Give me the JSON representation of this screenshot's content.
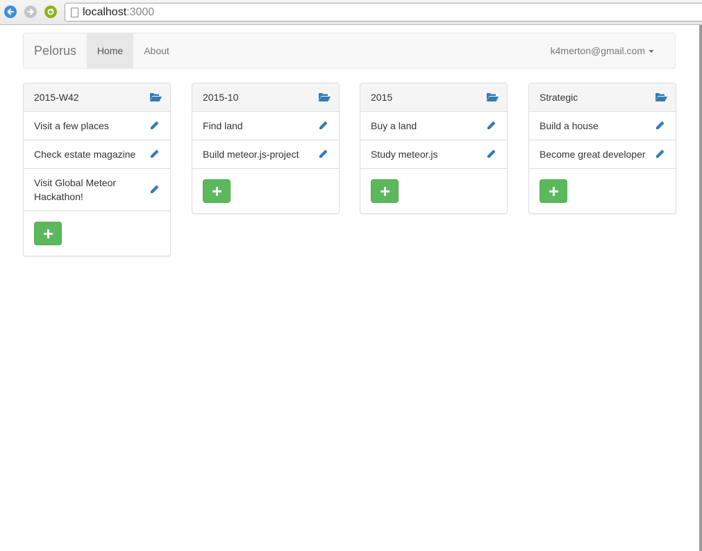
{
  "browser": {
    "url_host": "localhost",
    "url_port": ":3000"
  },
  "navbar": {
    "brand": "Pelorus",
    "items": [
      {
        "label": "Home",
        "active": true
      },
      {
        "label": "About",
        "active": false
      }
    ],
    "user": "k4merton@gmail.com"
  },
  "panels": [
    {
      "title": "2015-W42",
      "items": [
        "Visit a few places",
        "Check estate magazine",
        "Visit Global Meteor Hackathon!"
      ]
    },
    {
      "title": "2015-10",
      "items": [
        "Find land",
        "Build meteor.js-project"
      ]
    },
    {
      "title": "2015",
      "items": [
        "Buy a land",
        "Study meteor.js"
      ]
    },
    {
      "title": "Strategic",
      "items": [
        "Build a house",
        "Become great developer"
      ]
    }
  ],
  "colors": {
    "accent": "#337ab7",
    "success": "#5cb85c"
  },
  "icons": {
    "panel": "folder-open-icon",
    "item": "pencil-icon",
    "add": "plus-icon"
  }
}
